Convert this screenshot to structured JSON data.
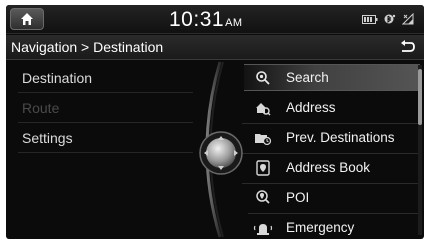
{
  "status": {
    "time": "10:31",
    "ampm": "AM",
    "icons": [
      "battery-icon",
      "bluetooth-icon",
      "signal-icon"
    ]
  },
  "header": {
    "breadcrumb": "Navigation > Destination",
    "back_icon": "back-arrow-icon"
  },
  "left_menu": {
    "items": [
      {
        "label": "Destination",
        "enabled": true
      },
      {
        "label": "Route",
        "enabled": false
      },
      {
        "label": "Settings",
        "enabled": true
      }
    ]
  },
  "right_menu": {
    "items": [
      {
        "label": "Search",
        "icon": "search-icon",
        "selected": true
      },
      {
        "label": "Address",
        "icon": "address-icon",
        "selected": false
      },
      {
        "label": "Prev. Destinations",
        "icon": "previous-destinations-icon",
        "selected": false
      },
      {
        "label": "Address Book",
        "icon": "address-book-icon",
        "selected": false
      },
      {
        "label": "POI",
        "icon": "poi-icon",
        "selected": false
      },
      {
        "label": "Emergency",
        "icon": "emergency-icon",
        "selected": false
      }
    ]
  },
  "colors": {
    "background": "#0b0b0b",
    "text": "#ffffff",
    "disabled_text": "#4a4a4a"
  }
}
